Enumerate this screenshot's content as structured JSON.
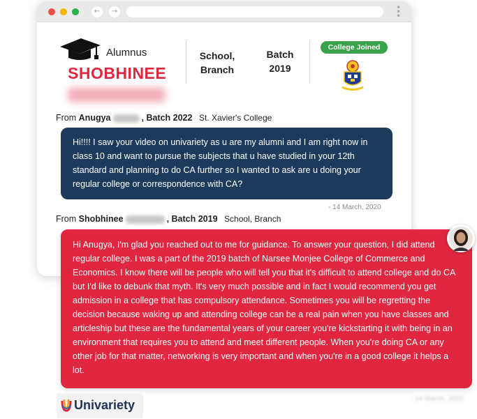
{
  "alumnus": {
    "label": "Alumnus",
    "name": "SHOBHINEE"
  },
  "details": {
    "school_line1": "School,",
    "school_line2": "Branch",
    "batch_label": "Batch",
    "batch_year": "2019",
    "college_badge": "College Joined"
  },
  "question": {
    "from_prefix": "From",
    "sender_first": "Anugya",
    "batch": ", Batch 2022",
    "college": "St. Xavier's College",
    "text": "Hi!!!! I saw your video on univariety as u are my alumni and I am right now in class 10 and  want to pursue the subjects that u have studied in your 12th standard and planning to do CA further so I wanted to ask are u doing your regular college or correspondence with CA?",
    "date": "- 14 March, 2020"
  },
  "answer": {
    "from_prefix": "From",
    "sender_first": "Shobhinee",
    "batch": ", Batch 2019",
    "college": "School, Branch",
    "text": "Hi Anugya, I'm glad you reached out to me for guidance. To answer your question, I did attend regular college. I was a part of the 2019 batch of Narsee Monjee College of Commerce and Economics. I know there will be people who will tell you that it's difficult to attend college and do CA but I'd like to debunk that myth. It's very much possible and in fact I would recommend you get admission in a college that has compulsory attendance. Sometimes you will be regretting the decision because waking up and attending college can be a real pain when you have classes and articleship but these are the fundamental years of your career you're kickstarting it with being in an environment that requires you to attend and meet different people. When you're doing CA or any other job for that matter, networking is very important and when you're in a good college it helps a lot."
  },
  "brand": {
    "name": "Univariety"
  },
  "icons": {
    "graduation": "graduation-cap-icon",
    "crest": "college-crest-icon",
    "avatar": "user-avatar",
    "logo": "univariety-logo-icon"
  },
  "colors": {
    "accent_red": "#e0273f",
    "navy": "#1c3a5c",
    "badge_green": "#38a34a"
  }
}
